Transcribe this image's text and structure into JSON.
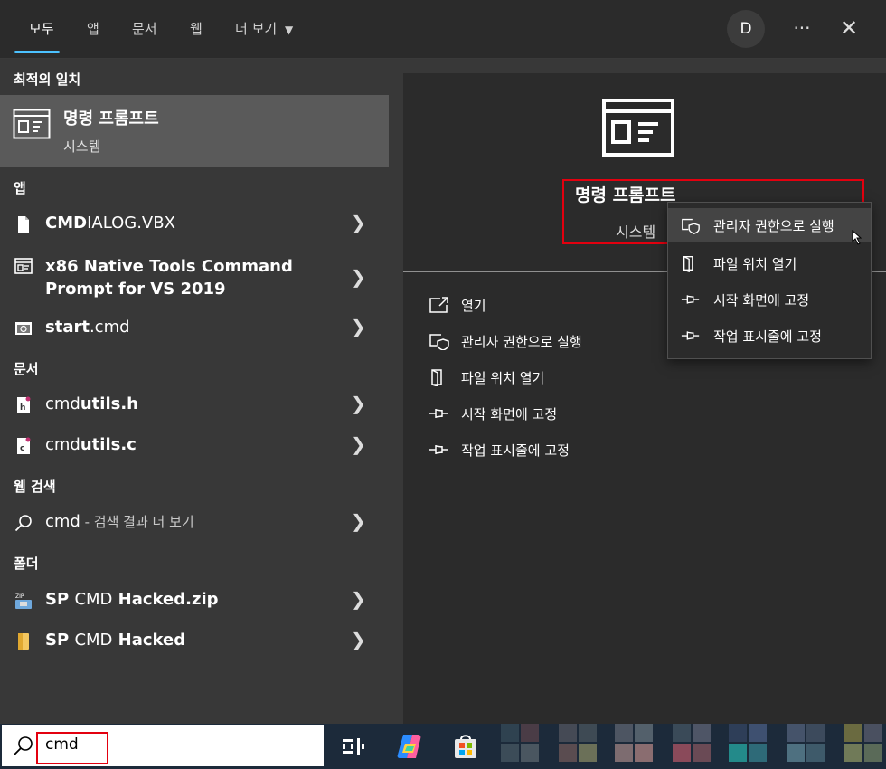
{
  "tabs": {
    "all": "모두",
    "apps": "앱",
    "docs": "문서",
    "web": "웹",
    "more": "더 보기",
    "avatar": "D",
    "menu_icon": "ellipsis-icon",
    "close_icon": "close-icon"
  },
  "left": {
    "best_match_header": "최적의 일치",
    "best_match": {
      "title": "명령 프롬프트",
      "subtitle": "시스템"
    },
    "apps_header": "앱",
    "apps": [
      {
        "bold": "CMD",
        "rest": "IALOG.VBX"
      },
      {
        "line1": "x86 Native Tools Command",
        "line2": "Prompt for VS 2019"
      },
      {
        "pre": "start",
        "rest": ".cmd"
      }
    ],
    "docs_header": "문서",
    "docs": [
      {
        "bold": "cmd",
        "rest": "utils.h"
      },
      {
        "bold": "cmd",
        "rest": "utils.c"
      }
    ],
    "web_header": "웹 검색",
    "web": {
      "query": "cmd",
      "hint": " - 검색 결과 더 보기"
    },
    "folders_header": "폴더",
    "folders": [
      {
        "pre": "SP ",
        "bold": "CMD",
        "rest": " Hacked.zip"
      },
      {
        "pre": "SP ",
        "bold": "CMD",
        "rest": " Hacked"
      }
    ]
  },
  "preview": {
    "title": "명령 프롬프트",
    "subtitle": "시스템",
    "actions": [
      {
        "label": "열기",
        "icon": "open-icon"
      },
      {
        "label": "관리자 권한으로 실행",
        "icon": "shield-icon"
      },
      {
        "label": "파일 위치 열기",
        "icon": "folder-location-icon"
      },
      {
        "label": "시작 화면에 고정",
        "icon": "pin-icon"
      },
      {
        "label": "작업 표시줄에 고정",
        "icon": "pin-icon"
      }
    ]
  },
  "context_menu": {
    "items": [
      {
        "label": "관리자 권한으로 실행",
        "icon": "shield-icon"
      },
      {
        "label": "파일 위치 열기",
        "icon": "folder-location-icon"
      },
      {
        "label": "시작 화면에 고정",
        "icon": "pin-icon"
      },
      {
        "label": "작업 표시줄에 고정",
        "icon": "pin-icon"
      }
    ]
  },
  "taskbar": {
    "search_value": "cmd",
    "icons": [
      "task-view-icon",
      "copilot-icon",
      "store-icon"
    ]
  },
  "colors": {
    "highlight_box": "#e3000f",
    "accent": "#4cc2ff"
  }
}
